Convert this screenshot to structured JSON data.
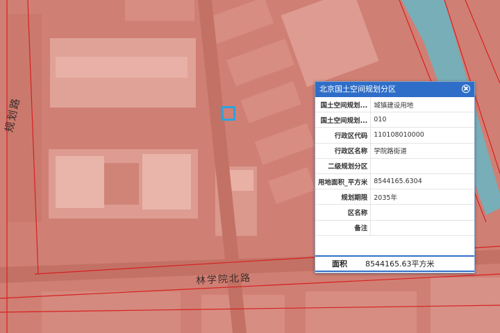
{
  "map": {
    "road_bottom": "林学院北路",
    "road_left": "规划路"
  },
  "popup": {
    "title": "北京国土空间规划分区",
    "rows": [
      {
        "key": "国土空间规划...",
        "value": "城镇建设用地"
      },
      {
        "key": "国土空间规划...",
        "value": "010"
      },
      {
        "key": "行政区代码",
        "value": "110108010000"
      },
      {
        "key": "行政区名称",
        "value": "学院路街道"
      },
      {
        "key": "二级规划分区",
        "value": ""
      },
      {
        "key": "用地面积_平方米",
        "value": "8544165.6304"
      },
      {
        "key": "规划期限",
        "value": "2035年"
      },
      {
        "key": "区名称",
        "value": ""
      },
      {
        "key": "备注",
        "value": ""
      }
    ],
    "footer_key": "面积",
    "footer_value": "8544165.63平方米"
  },
  "colors": {
    "zone_fill": "#d9897e",
    "water_fill": "#4fc8dc",
    "boundary": "#d62020",
    "header": "#2f6ec8",
    "selection": "#2aa3e0"
  }
}
